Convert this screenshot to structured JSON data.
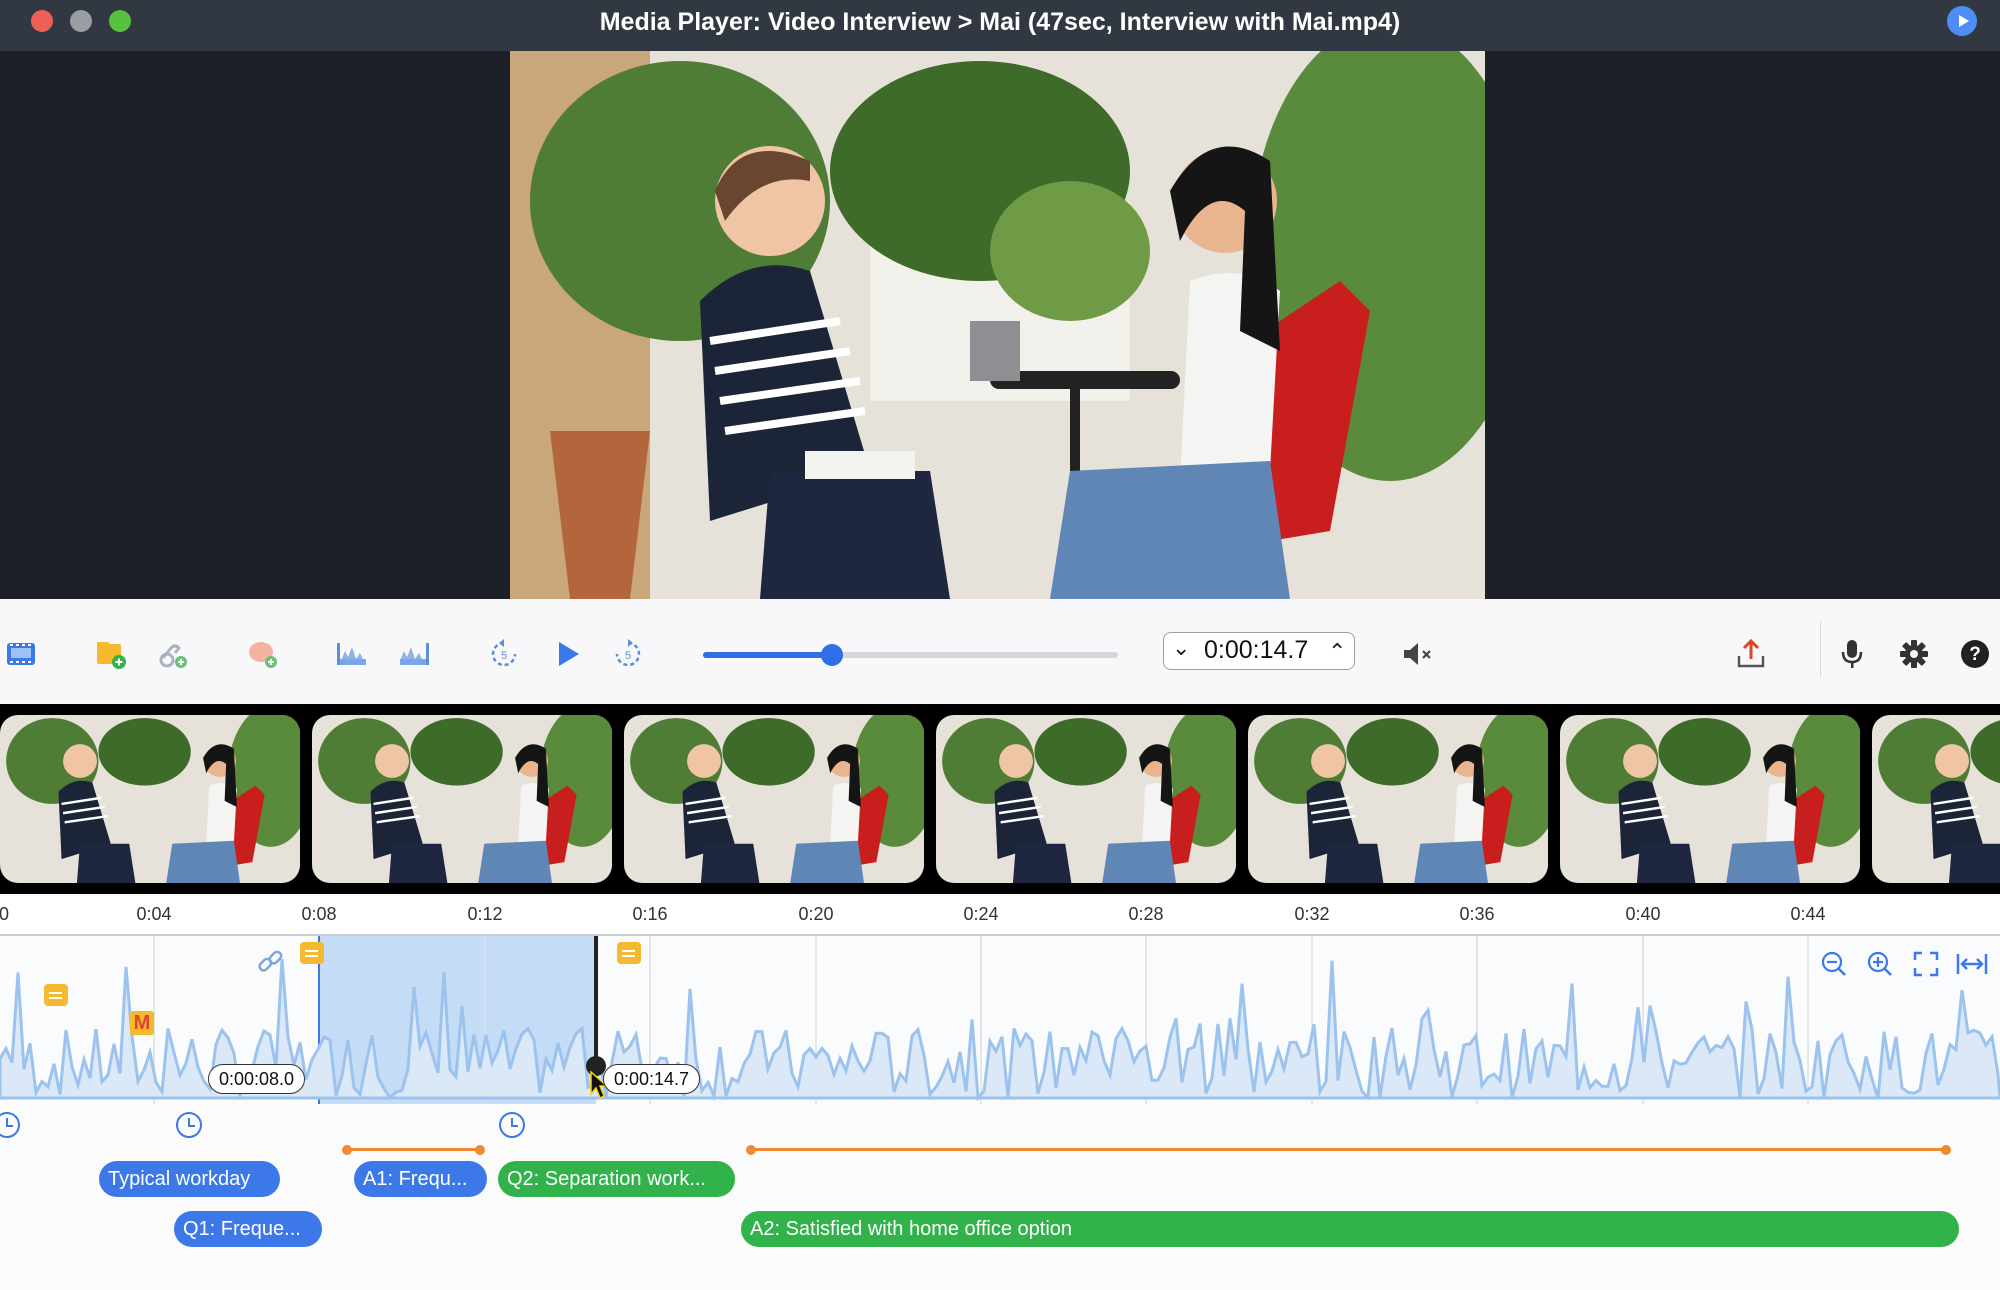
{
  "window": {
    "title": "Media Player: Video Interview > Mai (47sec, Interview with Mai.mp4)"
  },
  "toolbar": {
    "time_display": "0:00:14.7",
    "playback_progress": 0.31
  },
  "ruler": {
    "ticks": [
      "0",
      "0:04",
      "0:08",
      "0:12",
      "0:16",
      "0:20",
      "0:24",
      "0:28",
      "0:32",
      "0:36",
      "0:40",
      "0:44"
    ]
  },
  "selection": {
    "start_label": "0:00:08.0",
    "end_label": "0:00:14.7"
  },
  "codes": {
    "row1": [
      {
        "label": "Typical workday",
        "color": "#3c78e8"
      },
      {
        "label": "A1: Frequ...",
        "color": "#3c78e8"
      },
      {
        "label": "Q2: Separation work...",
        "color": "#31b24b"
      }
    ],
    "row2": [
      {
        "label": "Q1: Freque...",
        "color": "#3c78e8"
      },
      {
        "label": "A2: Satisfied with home office option",
        "color": "#31b24b"
      }
    ]
  },
  "markers": {
    "memo_letter": "M"
  },
  "colors": {
    "accent": "#2f6fe4",
    "selection": "#c5dcf7",
    "waveform": "#9cc3ee",
    "range_line": "#f0892f"
  }
}
